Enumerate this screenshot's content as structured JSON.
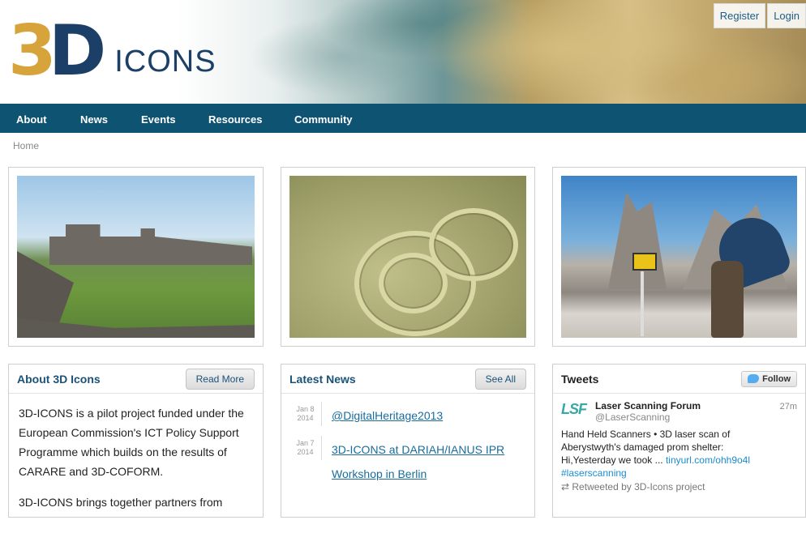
{
  "header": {
    "logo_3": "3",
    "logo_d": "D",
    "logo_word": "ICONS",
    "register_label": "Register",
    "login_label": "Login"
  },
  "nav": {
    "items": [
      {
        "label": "About"
      },
      {
        "label": "News"
      },
      {
        "label": "Events"
      },
      {
        "label": "Resources"
      },
      {
        "label": "Community"
      }
    ]
  },
  "breadcrumb": {
    "home": "Home"
  },
  "about": {
    "title": "About 3D Icons",
    "button": "Read More",
    "paragraph1": "3D-ICONS is a pilot project funded under the European Commission's ICT Policy Support Programme which builds on the results of CARARE and 3D-COFORM.",
    "paragraph2": "3D-ICONS brings together partners from"
  },
  "news": {
    "title": "Latest News",
    "button": "See All",
    "items": [
      {
        "month_day": "Jan 8",
        "year": "2014",
        "title": "@DigitalHeritage2013"
      },
      {
        "month_day": "Jan 7",
        "year": "2014",
        "title": "3D-ICONS at DARIAH/IANUS IPR",
        "title_line2": "Workshop in Berlin"
      }
    ]
  },
  "tweets": {
    "title": "Tweets",
    "follow_label": "Follow",
    "tweet": {
      "logo_text": "LSF",
      "name": "Laser Scanning Forum",
      "handle": "@LaserScanning",
      "time": "27m",
      "body_line1": "Hand Held Scanners • 3D laser scan of",
      "body_line2": "Aberystwyth's damaged prom shelter:",
      "body_line3_text": "Hi,Yesterday we took ... ",
      "body_link": "tinyurl.com/ohh9o4l",
      "hashtag": "#laserscanning",
      "retweet": "Retweeted by 3D-Icons project"
    }
  }
}
